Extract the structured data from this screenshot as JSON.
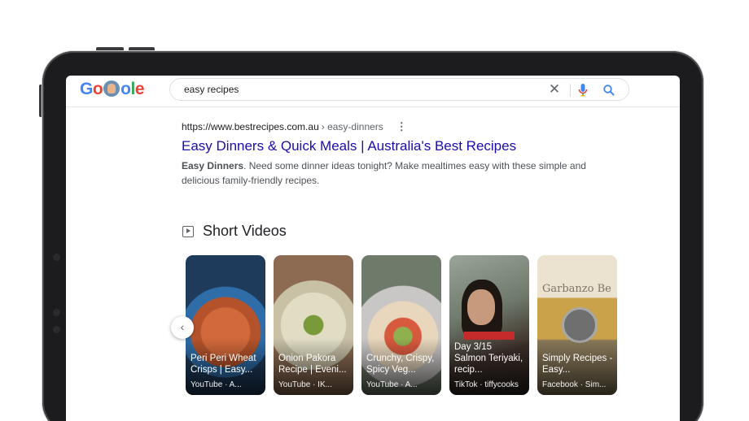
{
  "header": {
    "logo_letters": [
      "G",
      "o",
      "o",
      "l",
      "e"
    ],
    "search_value": "easy recipes"
  },
  "result": {
    "url": "https://www.bestrecipes.com.au",
    "breadcrumb": "› easy-dinners",
    "title": "Easy Dinners & Quick Meals | Australia's Best Recipes",
    "snippet_bold": "Easy Dinners",
    "snippet_rest": ". Need some dinner ideas tonight? Make mealtimes easy with these simple and delicious family-friendly recipes."
  },
  "short_videos": {
    "heading": "Short Videos",
    "cards": [
      {
        "title": "Peri Peri Wheat Crisps | Easy...",
        "source": "YouTube · A..."
      },
      {
        "title": "Onion Pakora Recipe | Eveni...",
        "source": "YouTube · IK..."
      },
      {
        "title": "Crunchy, Crispy, Spicy Veg...",
        "source": "YouTube · A..."
      },
      {
        "title": "Day 3/15 Salmon Teriyaki, recip...",
        "source": "TikTok · tiffycooks"
      },
      {
        "title": "Simply Recipes - Easy...",
        "source": "Facebook · Sim..."
      }
    ],
    "card5_overlay_text": "Garbanzo Be"
  },
  "colors": {
    "link": "#1a0dab",
    "google_blue": "#4285f4",
    "google_red": "#ea4335",
    "google_yellow": "#fbbc05",
    "google_green": "#34a853"
  },
  "icons": [
    "clear-icon",
    "mic-icon",
    "search-icon",
    "more-options-icon",
    "short-videos-icon",
    "chevron-left-icon"
  ]
}
